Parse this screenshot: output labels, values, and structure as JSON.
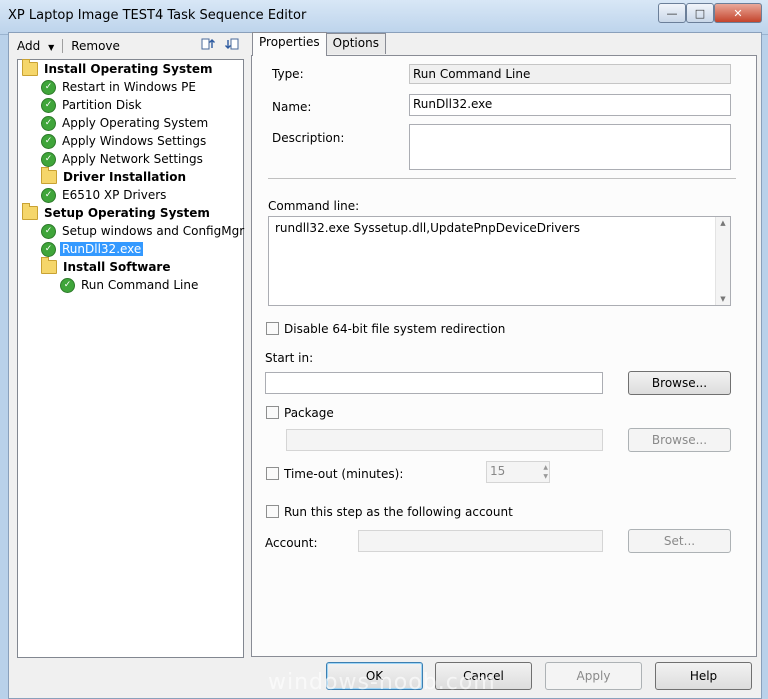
{
  "window": {
    "title": "XP Laptop Image TEST4 Task Sequence Editor"
  },
  "toolbar": {
    "add_label": "Add",
    "remove_label": "Remove"
  },
  "tree": [
    {
      "label": "Install Operating System",
      "type": "group",
      "level": 0
    },
    {
      "label": "Restart in Windows PE",
      "type": "step",
      "level": 1
    },
    {
      "label": "Partition Disk",
      "type": "step",
      "level": 1
    },
    {
      "label": "Apply Operating System",
      "type": "step",
      "level": 1
    },
    {
      "label": "Apply Windows Settings",
      "type": "step",
      "level": 1
    },
    {
      "label": "Apply Network Settings",
      "type": "step",
      "level": 1
    },
    {
      "label": "Driver Installation",
      "type": "group",
      "level": 1
    },
    {
      "label": "E6510 XP Drivers",
      "type": "step",
      "level": 1
    },
    {
      "label": "Setup Operating System",
      "type": "group",
      "level": 0
    },
    {
      "label": "Setup windows and ConfigMgr",
      "type": "step",
      "level": 1
    },
    {
      "label": "RunDll32.exe",
      "type": "step",
      "level": 1,
      "selected": true
    },
    {
      "label": "Install Software",
      "type": "group",
      "level": 1
    },
    {
      "label": "Run Command Line",
      "type": "step",
      "level": 2
    }
  ],
  "tabs": {
    "properties": "Properties",
    "options": "Options"
  },
  "props": {
    "type_label": "Type:",
    "type_value": "Run Command Line",
    "name_label": "Name:",
    "name_value": "RunDll32.exe",
    "description_label": "Description:",
    "description_value": "",
    "command_line_label": "Command line:",
    "command_line_value": "rundll32.exe Syssetup.dll,UpdatePnpDeviceDrivers",
    "disable64_label": "Disable 64-bit file system redirection",
    "start_in_label": "Start in:",
    "start_in_value": "",
    "browse_label": "Browse...",
    "package_label": "Package",
    "package_value": "",
    "timeout_label": "Time-out (minutes):",
    "timeout_value": "15",
    "run_as_label": "Run this step as the following account",
    "account_label": "Account:",
    "account_value": "",
    "set_label": "Set..."
  },
  "buttons": {
    "ok": "OK",
    "cancel": "Cancel",
    "apply": "Apply",
    "help": "Help"
  },
  "watermark": "windows-noob.com"
}
